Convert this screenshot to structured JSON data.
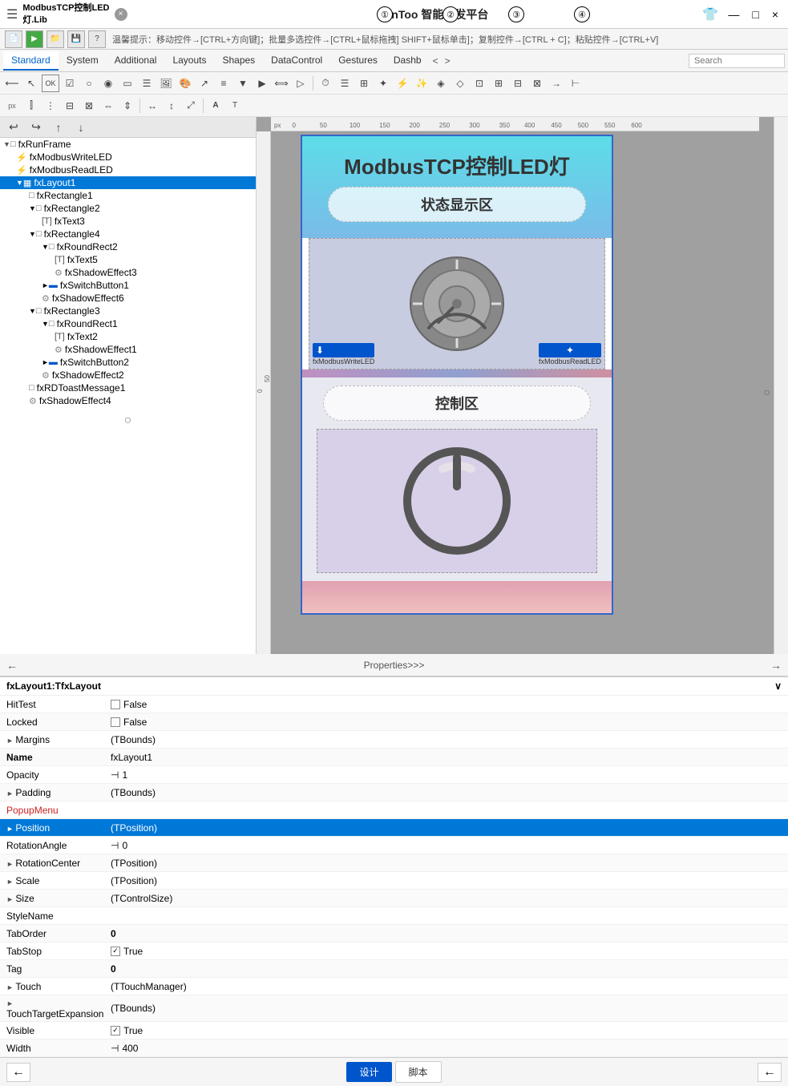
{
  "window": {
    "title_line1": "ModbusTCP控制LED",
    "title_line2": "灯.Lib",
    "close_btn": "×",
    "center_title": "PinToo 智能开发平台",
    "min_btn": "—",
    "max_btn": "□",
    "close_win_btn": "×",
    "shirt_icon": "👕"
  },
  "annotations": [
    "①",
    "②",
    "③",
    "④"
  ],
  "toolbar": {
    "hint": "温馨提示：移动控件→[CTRL+方向键]；批量多选控件→[CTRL+鼠标拖拽] SHIFT+鼠标单击]；复制控件→[CTRL + C]；粘贴控件→[CTRL+V]"
  },
  "tabs": {
    "items": [
      "Standard",
      "System",
      "Additional",
      "Layouts",
      "Shapes",
      "DataControl",
      "Gestures",
      "Dashb"
    ],
    "active": "Standard",
    "search_placeholder": "Search"
  },
  "tree": {
    "items": [
      {
        "id": "fxRunFrame",
        "label": "fxRunFrame",
        "level": 0,
        "expanded": true,
        "icon": "□",
        "type": "frame"
      },
      {
        "id": "fxModbusWriteLED",
        "label": "fxModbusWriteLED",
        "level": 1,
        "icon": "⚡",
        "type": "modbus"
      },
      {
        "id": "fxModbusReadLED",
        "label": "fxModbusReadLED",
        "level": 1,
        "icon": "⚡",
        "type": "modbus"
      },
      {
        "id": "fxLayout1",
        "label": "fxLayout1",
        "level": 1,
        "expanded": true,
        "icon": "▦",
        "type": "layout",
        "selected": true
      },
      {
        "id": "fxRectangle1",
        "label": "fxRectangle1",
        "level": 2,
        "icon": "□",
        "type": "rect"
      },
      {
        "id": "fxRectangle2",
        "label": "fxRectangle2",
        "level": 2,
        "expanded": true,
        "icon": "□",
        "type": "rect"
      },
      {
        "id": "fxText3",
        "label": "fxText3",
        "level": 3,
        "icon": "T",
        "type": "text"
      },
      {
        "id": "fxRectangle4",
        "label": "fxRectangle4",
        "level": 2,
        "expanded": true,
        "icon": "□",
        "type": "rect"
      },
      {
        "id": "fxRoundRect2",
        "label": "fxRoundRect2",
        "level": 3,
        "expanded": true,
        "icon": "□",
        "type": "round"
      },
      {
        "id": "fxText5",
        "label": "fxText5",
        "level": 4,
        "icon": "T",
        "type": "text"
      },
      {
        "id": "fxShadowEffect3",
        "label": "fxShadowEffect3",
        "level": 4,
        "icon": "⚙",
        "type": "effect"
      },
      {
        "id": "fxSwitchButton1",
        "label": "fxSwitchButton1",
        "level": 3,
        "icon": "▬",
        "type": "switch"
      },
      {
        "id": "fxShadowEffect6",
        "label": "fxShadowEffect6",
        "level": 3,
        "icon": "⚙",
        "type": "effect"
      },
      {
        "id": "fxRectangle3",
        "label": "fxRectangle3",
        "level": 2,
        "expanded": true,
        "icon": "□",
        "type": "rect"
      },
      {
        "id": "fxRoundRect1",
        "label": "fxRoundRect1",
        "level": 3,
        "expanded": true,
        "icon": "□",
        "type": "round"
      },
      {
        "id": "fxText2",
        "label": "fxText2",
        "level": 4,
        "icon": "T",
        "type": "text"
      },
      {
        "id": "fxShadowEffect1",
        "label": "fxShadowEffect1",
        "level": 4,
        "icon": "⚙",
        "type": "effect"
      },
      {
        "id": "fxSwitchButton2",
        "label": "fxSwitchButton2",
        "level": 3,
        "icon": "▬",
        "type": "switch"
      },
      {
        "id": "fxShadowEffect2",
        "label": "fxShadowEffect2",
        "level": 3,
        "icon": "⚙",
        "type": "effect"
      },
      {
        "id": "fxRDToastMessage1",
        "label": "fxRDToastMessage1",
        "level": 2,
        "icon": "□",
        "type": "toast"
      },
      {
        "id": "fxShadowEffect4",
        "label": "fxShadowEffect4",
        "level": 2,
        "icon": "⚙",
        "type": "effect"
      }
    ]
  },
  "canvas": {
    "phone": {
      "title": "ModbusTCP控制LED灯",
      "status_label": "状态显示区",
      "control_label": "控制区",
      "write_label": "fxModbusWriteLED",
      "read_label": "fxModbusReadLED"
    }
  },
  "nav": {
    "back_arrow": "←",
    "forward_arrow": "→",
    "title": "Properties>>>"
  },
  "properties": {
    "header": "fxLayout1:TfxLayout",
    "collapse_icon": "∨",
    "rows": [
      {
        "name": "HitTest",
        "value_type": "checkbox",
        "value": "False",
        "checked": false,
        "indent": false,
        "expandable": false
      },
      {
        "name": "Locked",
        "value_type": "checkbox",
        "value": "False",
        "checked": false,
        "indent": false,
        "expandable": false
      },
      {
        "name": "Margins",
        "value_type": "text",
        "value": "(TBounds)",
        "indent": false,
        "expandable": true
      },
      {
        "name": "Name",
        "value_type": "text",
        "value": "fxLayout1",
        "indent": false,
        "expandable": false,
        "bold": true
      },
      {
        "name": "Opacity",
        "value_type": "icon_text",
        "value": "1",
        "indent": false,
        "expandable": false
      },
      {
        "name": "Padding",
        "value_type": "text",
        "value": "(TBounds)",
        "indent": false,
        "expandable": true
      },
      {
        "name": "PopupMenu",
        "value_type": "text",
        "value": "",
        "indent": false,
        "expandable": false,
        "red": true
      },
      {
        "name": "Position",
        "value_type": "text",
        "value": "(TPosition)",
        "indent": false,
        "expandable": true,
        "highlighted": true
      },
      {
        "name": "RotationAngle",
        "value_type": "icon_text",
        "value": "0",
        "indent": false,
        "expandable": false
      },
      {
        "name": "RotationCenter",
        "value_type": "text",
        "value": "(TPosition)",
        "indent": false,
        "expandable": true
      },
      {
        "name": "Scale",
        "value_type": "text",
        "value": "(TPosition)",
        "indent": false,
        "expandable": true
      },
      {
        "name": "Size",
        "value_type": "text",
        "value": "(TControlSize)",
        "indent": false,
        "expandable": true
      },
      {
        "name": "StyleName",
        "value_type": "text",
        "value": "",
        "indent": false,
        "expandable": false
      },
      {
        "name": "TabOrder",
        "value_type": "text",
        "value": "0",
        "indent": false,
        "expandable": false,
        "bold_val": true
      },
      {
        "name": "TabStop",
        "value_type": "checkbox",
        "value": "True",
        "checked": true,
        "indent": false,
        "expandable": false
      },
      {
        "name": "Tag",
        "value_type": "text",
        "value": "0",
        "indent": false,
        "expandable": false,
        "bold_val": true
      },
      {
        "name": "Touch",
        "value_type": "text",
        "value": "(TTouchManager)",
        "indent": false,
        "expandable": true
      },
      {
        "name": "TouchTargetExpansion",
        "value_type": "text",
        "value": "(TBounds)",
        "indent": false,
        "expandable": true
      },
      {
        "name": "Visible",
        "value_type": "checkbox",
        "value": "True",
        "checked": true,
        "indent": false,
        "expandable": false
      },
      {
        "name": "Width",
        "value_type": "icon_text",
        "value": "400",
        "indent": false,
        "expandable": false
      }
    ]
  },
  "bottom": {
    "left_arrow": "←",
    "design_btn": "设计",
    "script_btn": "脚本",
    "right_arrow": "←"
  }
}
